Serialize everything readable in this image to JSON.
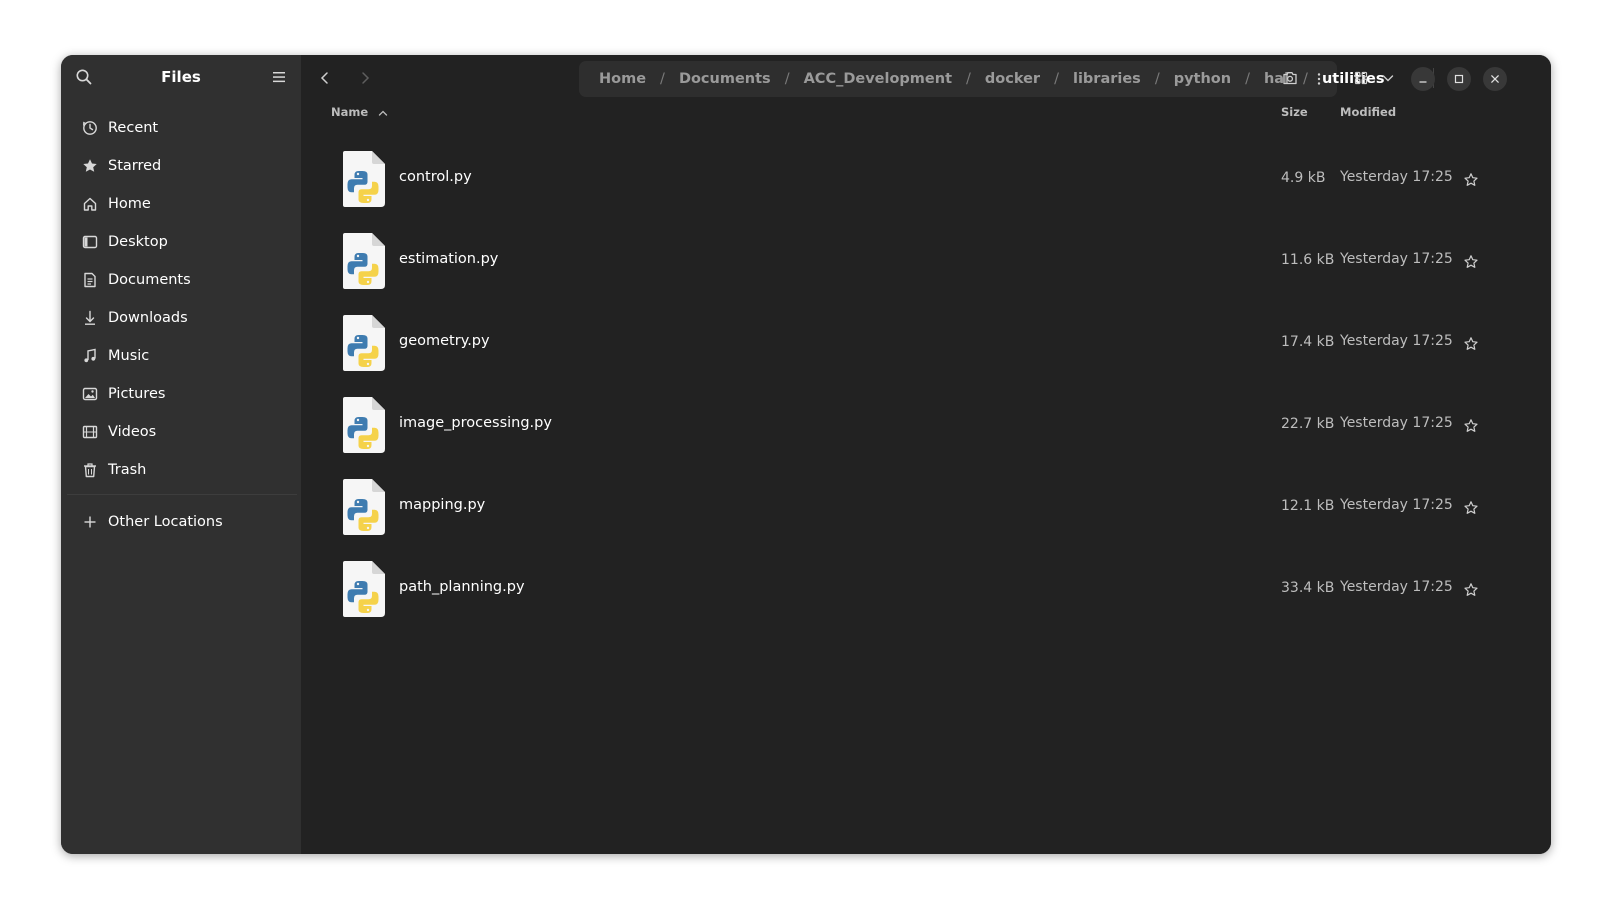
{
  "sidebar": {
    "title": "Files",
    "items": [
      {
        "label": "Recent",
        "icon": "clock-icon"
      },
      {
        "label": "Starred",
        "icon": "star-icon"
      },
      {
        "label": "Home",
        "icon": "home-icon"
      },
      {
        "label": "Desktop",
        "icon": "desktop-icon"
      },
      {
        "label": "Documents",
        "icon": "document-icon"
      },
      {
        "label": "Downloads",
        "icon": "download-icon"
      },
      {
        "label": "Music",
        "icon": "music-icon"
      },
      {
        "label": "Pictures",
        "icon": "picture-icon"
      },
      {
        "label": "Videos",
        "icon": "video-icon"
      },
      {
        "label": "Trash",
        "icon": "trash-icon"
      }
    ],
    "other_locations": "Other Locations"
  },
  "path": {
    "crumbs": [
      "Home",
      "Documents",
      "ACC_Development",
      "docker",
      "libraries",
      "python",
      "hal",
      "utilities"
    ],
    "separator": "/"
  },
  "columns": {
    "name": "Name",
    "size": "Size",
    "modified": "Modified"
  },
  "files": [
    {
      "name": "control.py",
      "size": "4.9 kB",
      "modified": "Yesterday 17:25"
    },
    {
      "name": "estimation.py",
      "size": "11.6 kB",
      "modified": "Yesterday 17:25"
    },
    {
      "name": "geometry.py",
      "size": "17.4 kB",
      "modified": "Yesterday 17:25"
    },
    {
      "name": "image_processing.py",
      "size": "22.7 kB",
      "modified": "Yesterday 17:25"
    },
    {
      "name": "mapping.py",
      "size": "12.1 kB",
      "modified": "Yesterday 17:25"
    },
    {
      "name": "path_planning.py",
      "size": "33.4 kB",
      "modified": "Yesterday 17:25"
    }
  ],
  "colors": {
    "window_bg": "#222222",
    "sidebar_bg": "#303030",
    "pathbar_bg": "#2e2e2e",
    "python_blue": "#3f7cb0",
    "python_yellow": "#f5d24a"
  }
}
